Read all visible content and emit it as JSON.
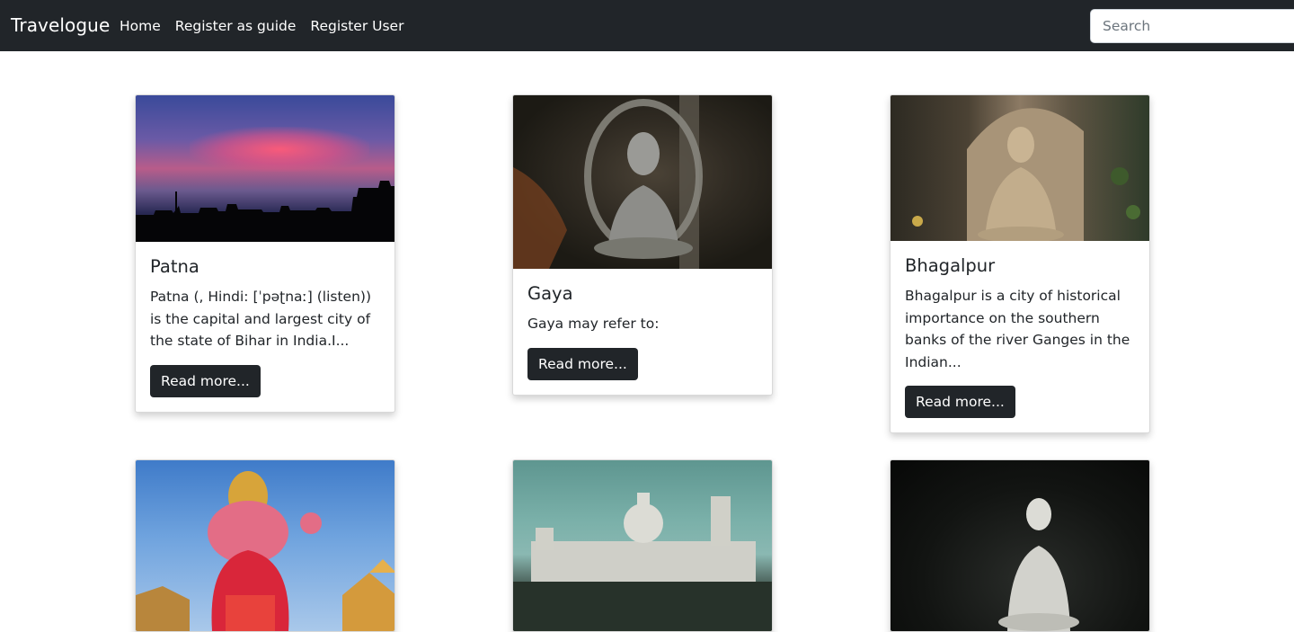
{
  "navbar": {
    "brand": "Travelogue",
    "links": [
      "Home",
      "Register as guide",
      "Register User"
    ],
    "search_placeholder": "Search"
  },
  "cards": [
    {
      "title": "Patna",
      "text": "Patna (, Hindi: [ˈpəʈnaː] (listen)) is the capital and largest city of the state of Bihar in India.I...",
      "button": "Read more..."
    },
    {
      "title": "Gaya",
      "text": "Gaya may refer to:",
      "button": "Read more..."
    },
    {
      "title": "Bhagalpur",
      "text": "Bhagalpur is a city of historical importance on the southern banks of the river Ganges in the Indian...",
      "button": "Read more..."
    }
  ],
  "colors": {
    "navbar_bg": "#212529",
    "button_bg": "#212529",
    "page_bg": "#ffffff"
  }
}
